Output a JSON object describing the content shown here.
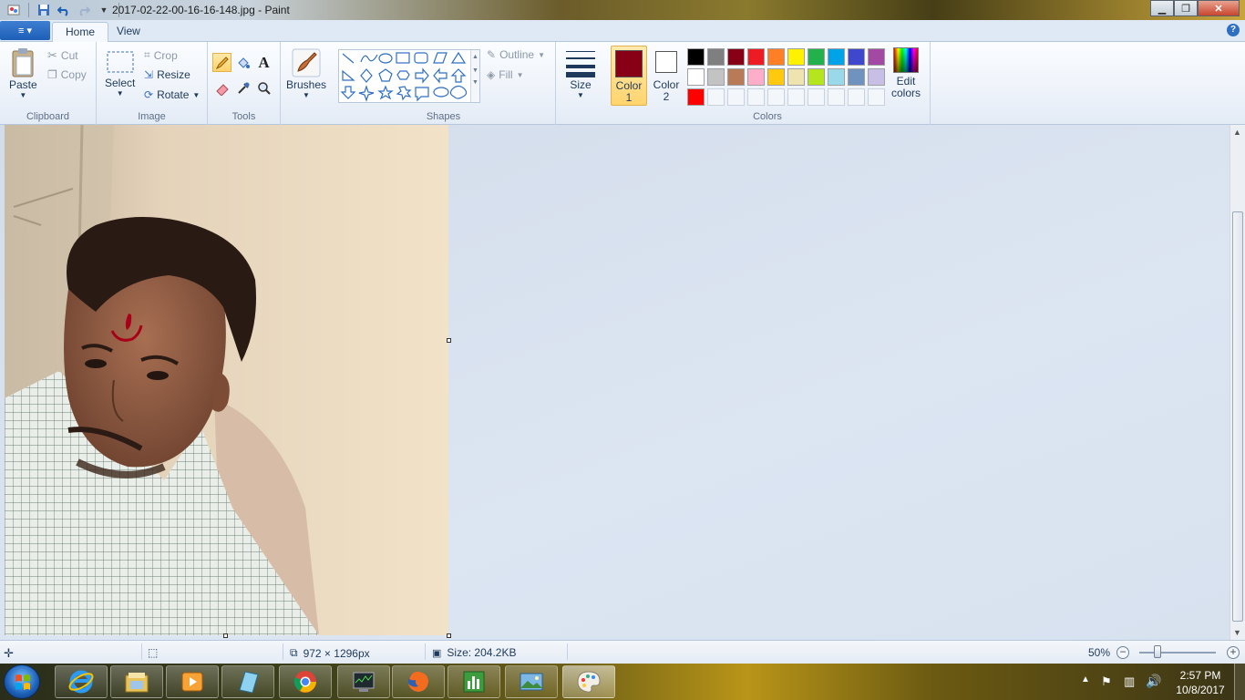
{
  "window": {
    "title": "2017-02-22-00-16-16-148.jpg - Paint",
    "minimize_label": "▁",
    "maximize_label": "❐",
    "close_label": "✕"
  },
  "tabs": {
    "file_label": "≡ ▾",
    "home": "Home",
    "view": "View",
    "help": "?"
  },
  "ribbon": {
    "clipboard": {
      "paste": "Paste",
      "cut": "Cut",
      "copy": "Copy",
      "label": "Clipboard"
    },
    "image": {
      "select": "Select",
      "crop": "Crop",
      "resize": "Resize",
      "rotate": "Rotate",
      "label": "Image"
    },
    "tools": {
      "label": "Tools",
      "text_tool": "A"
    },
    "brushes": {
      "label": "Brushes"
    },
    "shapes": {
      "outline": "Outline",
      "fill": "Fill",
      "label": "Shapes"
    },
    "size": {
      "label": "Size"
    },
    "colors": {
      "color1": "Color 1",
      "color1_value": "#880015",
      "color2": "Color 2",
      "color2_value": "#ffffff",
      "edit": "Edit colors",
      "label": "Colors",
      "palette_row1": [
        "#000000",
        "#7f7f7f",
        "#880015",
        "#ed1c24",
        "#ff7f27",
        "#fff200",
        "#22b14c",
        "#00a2e8",
        "#3f48cc",
        "#a349a4"
      ],
      "palette_row2": [
        "#ffffff",
        "#c3c3c3",
        "#b97a57",
        "#ffaec9",
        "#ffc90e",
        "#efe4b0",
        "#b5e61d",
        "#99d9ea",
        "#7092be",
        "#c8bfe7"
      ],
      "palette_row3": [
        "#ff0000"
      ]
    }
  },
  "status": {
    "dimensions": "972 × 1296px",
    "size": "Size: 204.2KB",
    "zoom": "50%",
    "zoom_fraction": 0.5
  },
  "taskbar": {
    "time": "2:57 PM",
    "date": "10/8/2017",
    "apps": [
      "internet-explorer",
      "file-explorer",
      "media-player",
      "notepad",
      "chrome",
      "task-manager",
      "firefox",
      "chart-app",
      "photo-viewer",
      "paint"
    ]
  }
}
